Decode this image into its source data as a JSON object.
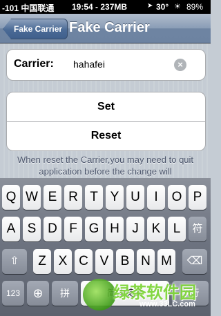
{
  "status_bar": {
    "signal": "-101 中国联通 ",
    "time": "19:54 - 237MB",
    "gps": "➤",
    "temp": "30°",
    "weather": "☀",
    "battery": "89%"
  },
  "nav": {
    "back_label": "Fake Carrier",
    "title": "Fake Carrier"
  },
  "form": {
    "carrier_label": "Carrier:",
    "carrier_value": "hahafei",
    "clear_icon": "×"
  },
  "buttons": {
    "set_label": "Set",
    "reset_label": "Reset"
  },
  "note": "When reset the Carrier,you may need to quit application before the change will",
  "keyboard": {
    "row1": [
      "Q",
      "W",
      "E",
      "R",
      "T",
      "Y",
      "U",
      "I",
      "O",
      "P"
    ],
    "row2": [
      "A",
      "S",
      "D",
      "F",
      "G",
      "H",
      "J",
      "K",
      "L",
      "符"
    ],
    "row3_shift": "⇧",
    "row3": [
      "Z",
      "X",
      "C",
      "V",
      "B",
      "N",
      "M"
    ],
    "row3_delete": "⌫",
    "row4_num": "123",
    "row4_globe": "⊕",
    "row4_pinyin": "拼",
    "row4_space": "简体英文",
    "row4_return": "换行"
  },
  "watermark": {
    "text": "绿茶软件园",
    "url": "www.33LC.com"
  }
}
